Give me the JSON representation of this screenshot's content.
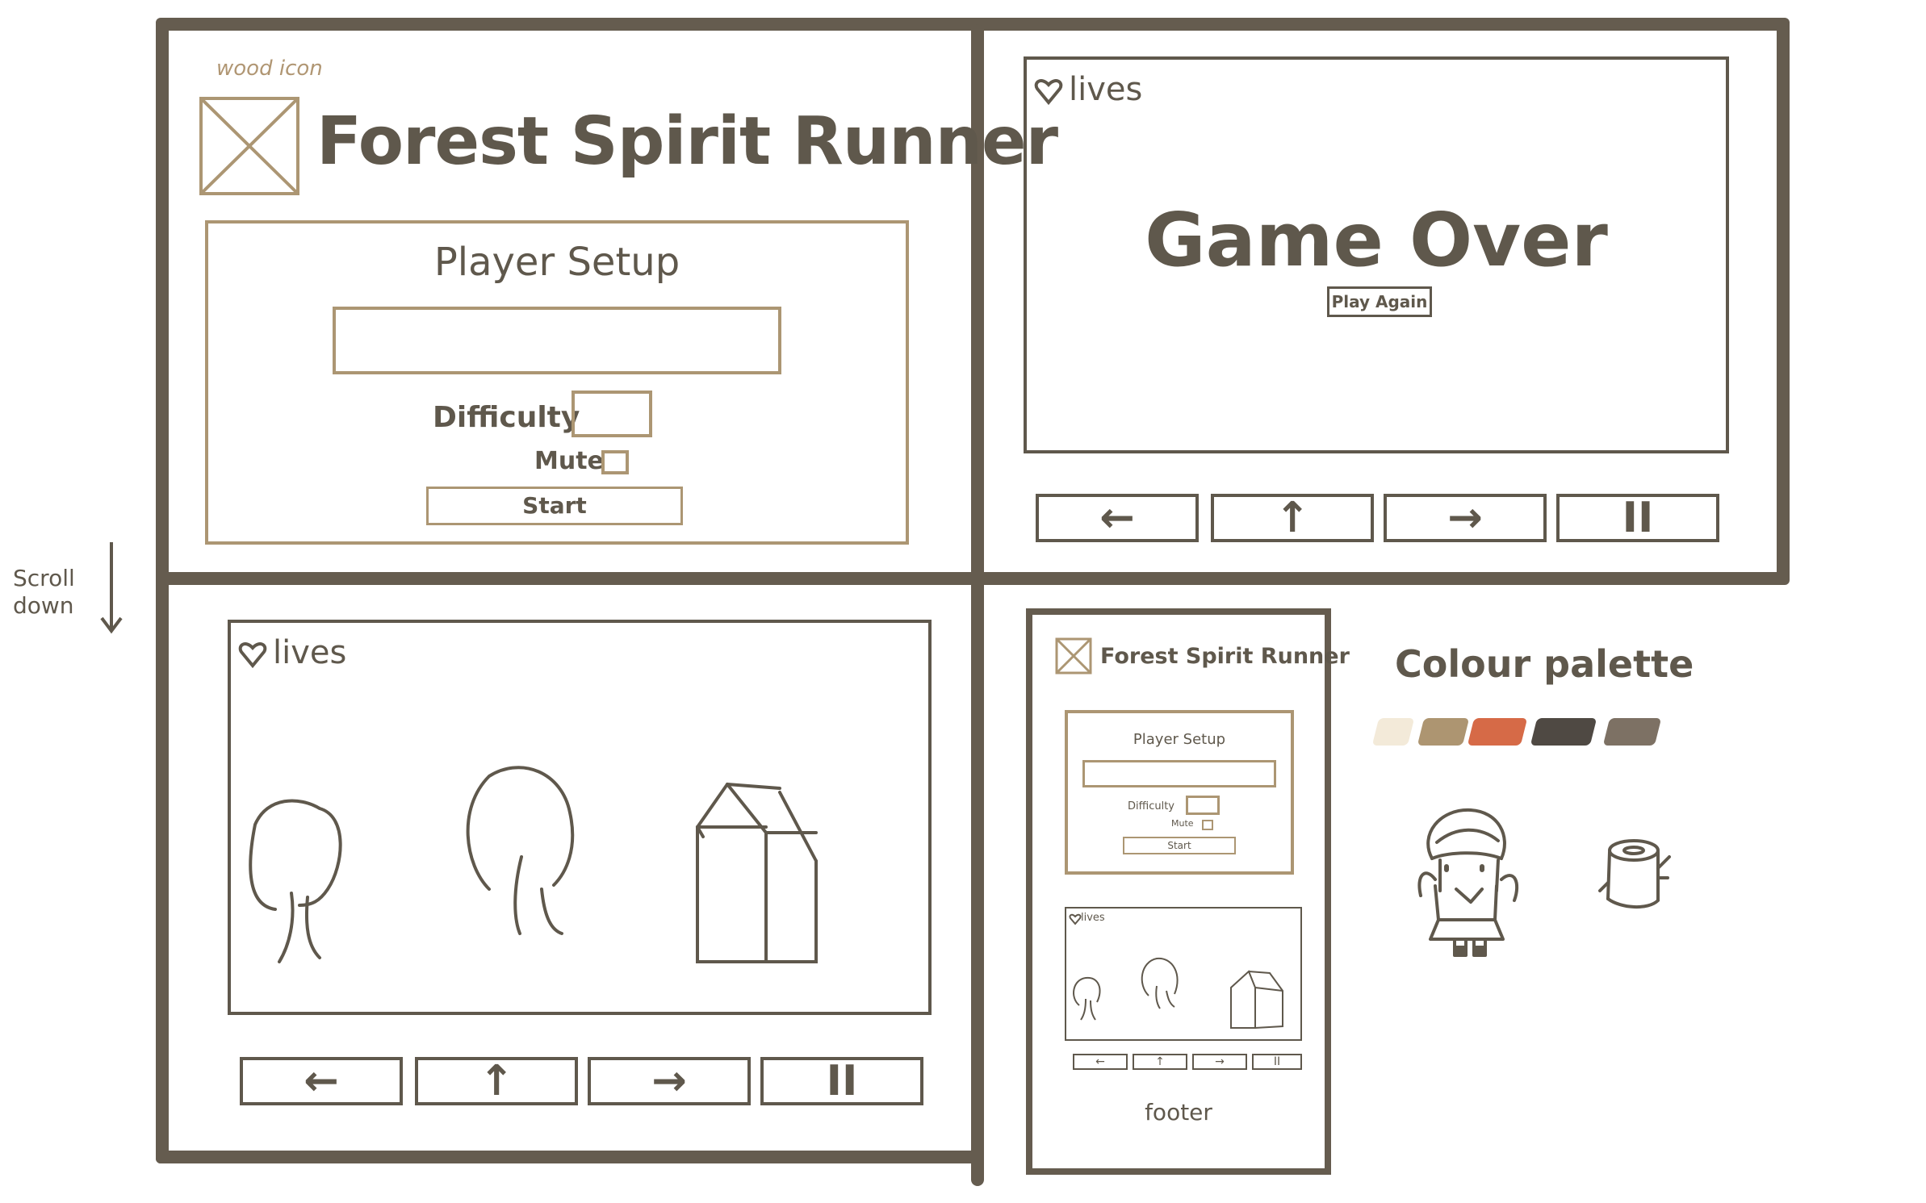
{
  "annotations": {
    "wood_icon": "wood icon",
    "scroll_down": [
      "Scroll",
      "down"
    ],
    "palette_title": "Colour palette",
    "footer": "footer"
  },
  "setup_screen": {
    "title": "Forest Spirit Runner",
    "panel_title": "Player Setup",
    "name_input_value": "",
    "difficulty_label": "Difficulty",
    "mute_label": "Mute",
    "start_label": "Start"
  },
  "game_over_screen": {
    "lives_label": "lives",
    "heading": "Game Over",
    "play_again_label": "Play Again"
  },
  "controls": {
    "left": "←",
    "up": "↑",
    "right": "→",
    "pause": "II"
  },
  "gameplay_screen": {
    "lives_label": "lives"
  },
  "mobile": {
    "title": "Forest Spirit Runner",
    "panel_title": "Player Setup",
    "difficulty_label": "Difficulty",
    "mute_label": "Mute",
    "start_label": "Start",
    "lives_label": "lives"
  },
  "palette_colors": [
    "#f3ead9",
    "#ad9571",
    "#d66a47",
    "#4f4943",
    "#7d7164"
  ],
  "icons": [
    "heart-icon",
    "wood-icon",
    "tree-icon",
    "house-icon",
    "spirit-character",
    "log-stump"
  ]
}
